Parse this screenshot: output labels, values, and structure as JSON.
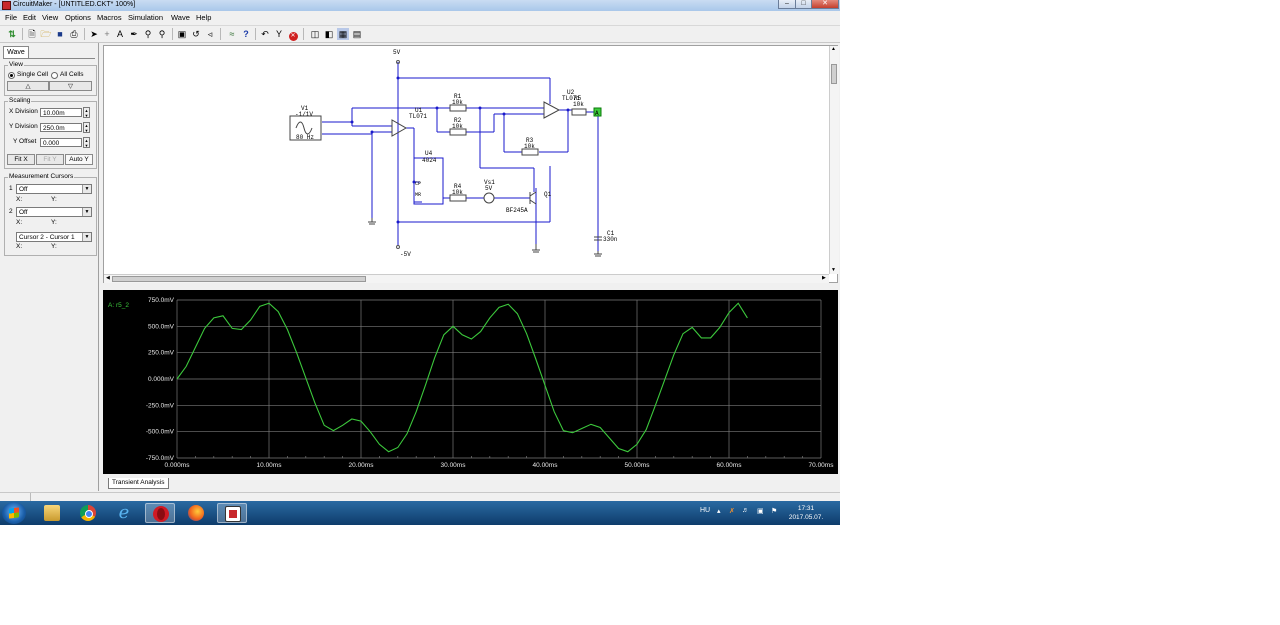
{
  "window": {
    "title": "CircuitMaker - [UNTITLED.CKT* 100%]"
  },
  "menu": [
    "File",
    "Edit",
    "View",
    "Options",
    "Macros",
    "Simulation",
    "Wave",
    "Help"
  ],
  "left_panel": {
    "tab": "Wave",
    "view": {
      "label": "View",
      "single_cell": "Single Cell",
      "all_cells": "All Cells",
      "up_symbol": "△",
      "down_symbol": "▽"
    },
    "scaling": {
      "label": "Scaling",
      "x_division_label": "X Division",
      "x_division": "10.00m",
      "y_division_label": "Y Division",
      "y_division": "250.0m",
      "y_offset_label": "Y Offset",
      "y_offset": "0.000",
      "fit_x": "Fit X",
      "fit_y": "Fit Y",
      "auto_y": "Auto Y"
    },
    "measurement": {
      "label": "Measurement Cursors",
      "cursor1_num": "1",
      "cursor1_value": "Off",
      "cursor2_num": "2",
      "cursor2_value": "Off",
      "diff_value": "Cursor 2 - Cursor 1",
      "x_label": "X:",
      "y_label": "Y:"
    }
  },
  "schematic": {
    "vcc": "5V",
    "vee": "-5V",
    "v1_name": "V1",
    "v1_value": "-1/1V",
    "v1_freq": "80 Hz",
    "u1_name": "U1",
    "u1_part": "TL071",
    "u2_name": "U2",
    "u2_part": "TL071",
    "r1_name": "R1",
    "r1_value": "10k",
    "r2_name": "R2",
    "r2_value": "10k",
    "r3_name": "R3",
    "r3_value": "10k",
    "r4_name": "R4",
    "r4_value": "10k",
    "r5_name": "R5",
    "r5_value": "10k",
    "u4_name": "U4",
    "u4_part": "4024",
    "u4_cp": "CP",
    "u4_mr": "MR",
    "vs1_name": "Vs1",
    "vs1_value": "5V",
    "q1_name": "Q1",
    "q1_part": "BF245A",
    "c1_name": "C1",
    "c1_value": "330n",
    "probe": "A"
  },
  "waveform": {
    "trace_label": "A: r5_2",
    "y_ticks": [
      "750.0mV",
      "500.0mV",
      "250.0mV",
      "0.000mV",
      "-250.0mV",
      "-500.0mV",
      "-750.0mV"
    ],
    "x_ticks": [
      "0.000ms",
      "10.00ms",
      "20.00ms",
      "30.00ms",
      "40.00ms",
      "50.00ms",
      "60.00ms",
      "70.00ms"
    ],
    "tab": "Transient Analysis"
  },
  "chart_data": {
    "type": "line",
    "title": "",
    "xlabel": "",
    "ylabel": "",
    "x_unit": "ms",
    "y_unit": "mV",
    "xlim": [
      0,
      70
    ],
    "ylim": [
      -750,
      750
    ],
    "grid": true,
    "series": [
      {
        "name": "A: r5_2",
        "color": "#3cc83c",
        "x": [
          0,
          1,
          2,
          3,
          4,
          5,
          6,
          7,
          8,
          9,
          10,
          11,
          12,
          13,
          14,
          15,
          16,
          17,
          18,
          19,
          20,
          21,
          22,
          23,
          24,
          25,
          26,
          27,
          28,
          29,
          30,
          31,
          32,
          33,
          34,
          35,
          36,
          37,
          38,
          39,
          40,
          41,
          42,
          43,
          44,
          45,
          46,
          47,
          48,
          49,
          50,
          51,
          52,
          53,
          54,
          55,
          56,
          57,
          58,
          59,
          60,
          61,
          62
        ],
        "y": [
          0,
          120,
          300,
          480,
          580,
          600,
          480,
          470,
          560,
          690,
          720,
          640,
          470,
          250,
          10,
          -230,
          -440,
          -490,
          -440,
          -380,
          -400,
          -500,
          -620,
          -690,
          -650,
          -520,
          -310,
          -60,
          200,
          420,
          500,
          420,
          380,
          450,
          580,
          680,
          710,
          620,
          430,
          190,
          -60,
          -310,
          -490,
          -510,
          -470,
          -430,
          -460,
          -560,
          -660,
          -690,
          -620,
          -480,
          -250,
          -10,
          230,
          430,
          490,
          390,
          390,
          490,
          630,
          720,
          580
        ]
      }
    ]
  },
  "taskbar": {
    "lang": "HU",
    "time": "17:31",
    "date": "2017.05.07."
  }
}
